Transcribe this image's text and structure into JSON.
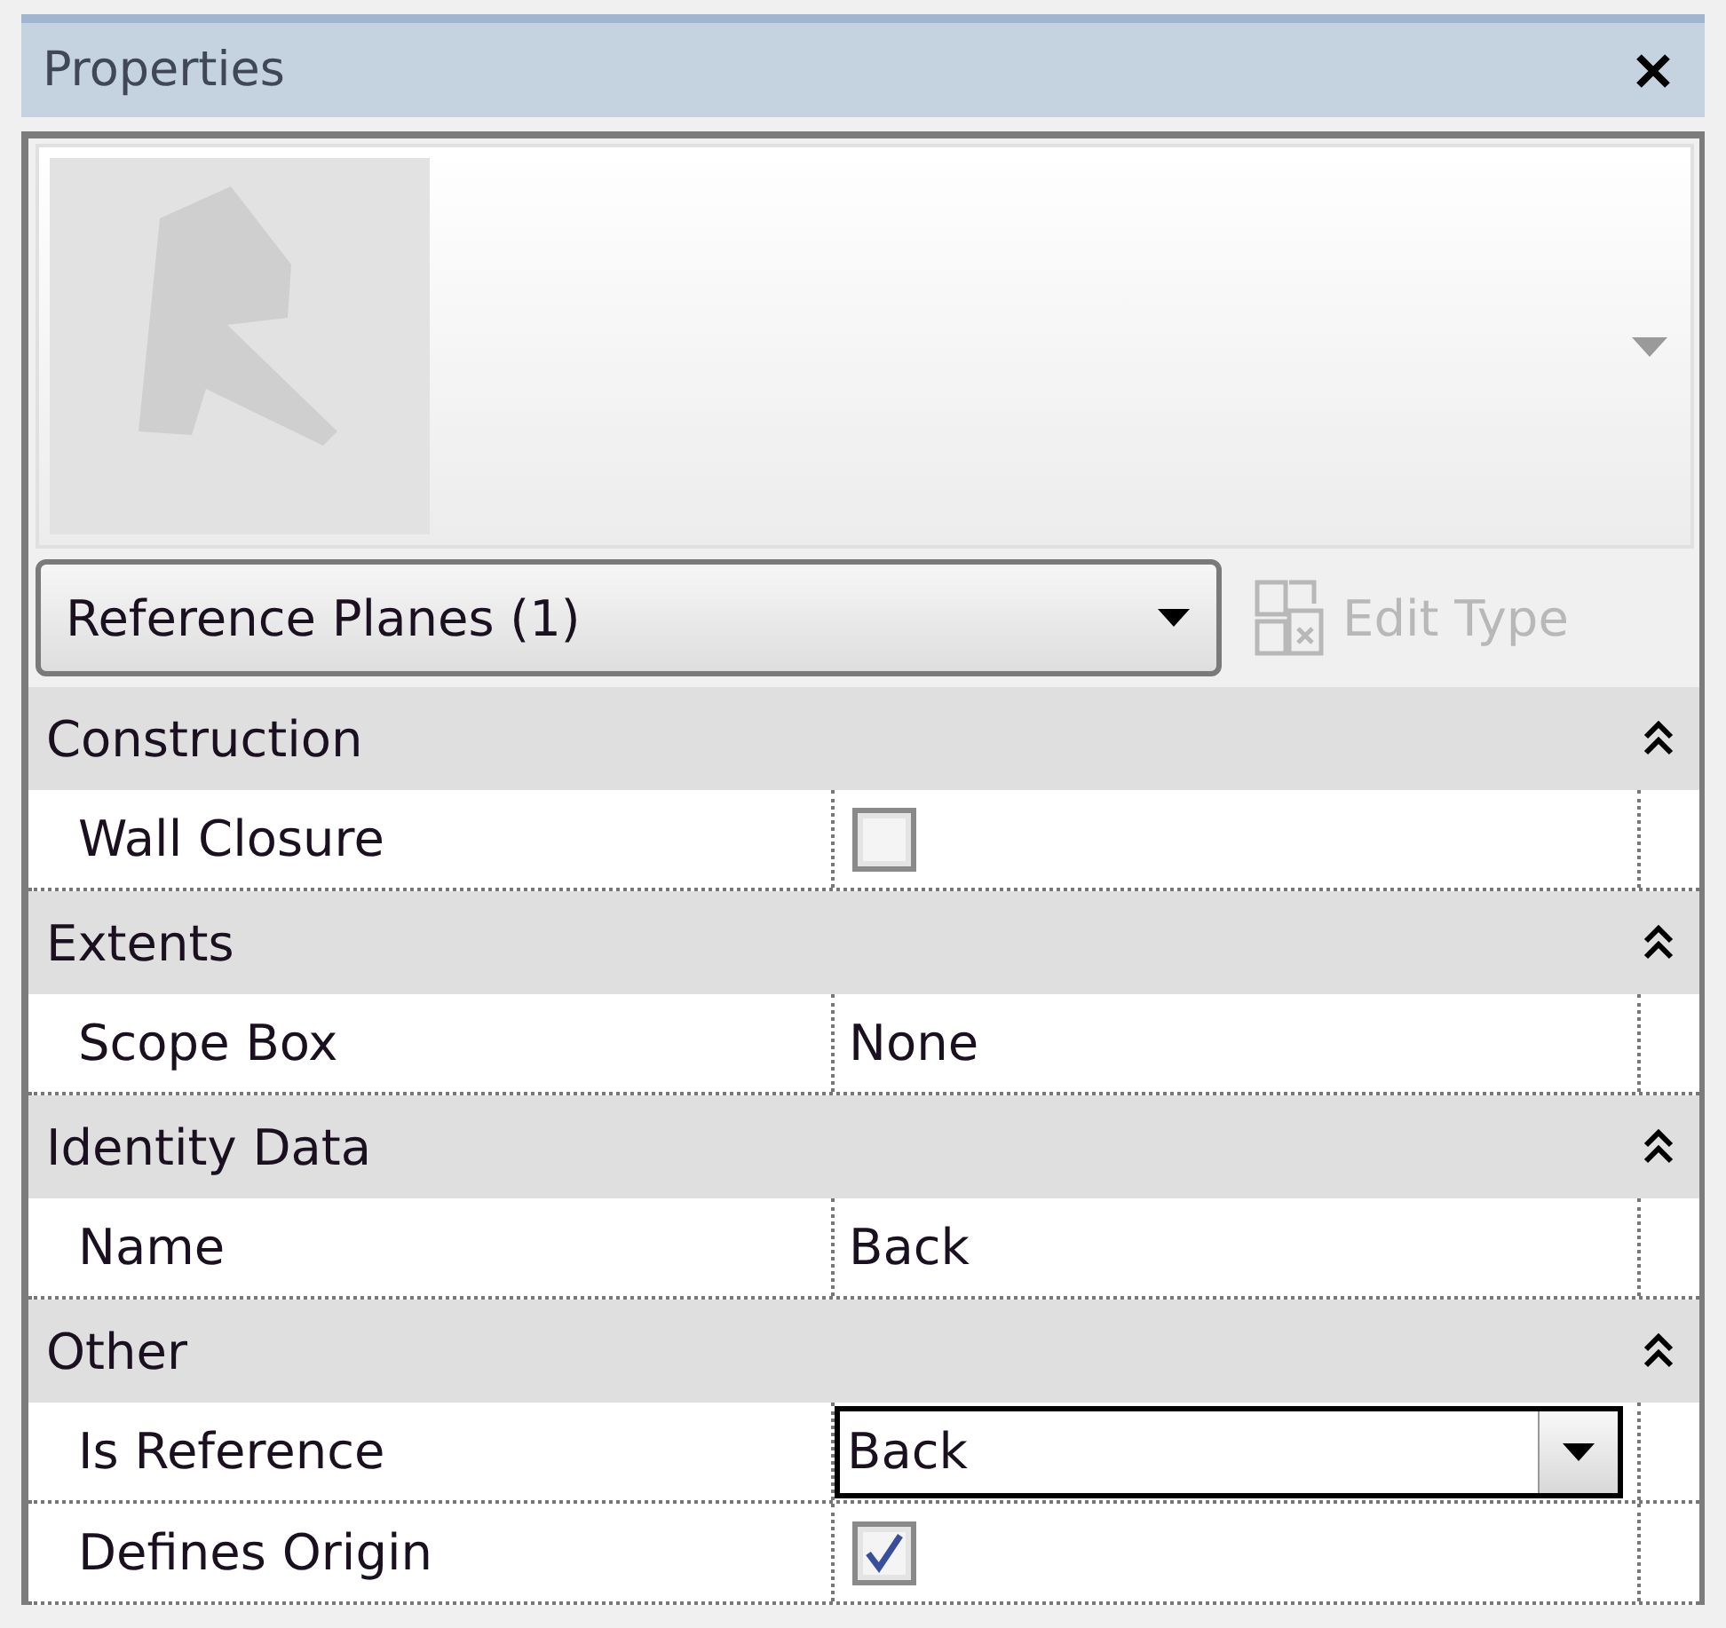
{
  "panel": {
    "title": "Properties"
  },
  "type_selector": {
    "value": "Reference Planes (1)"
  },
  "edit_type": {
    "label": "Edit Type",
    "disabled": true
  },
  "groups": [
    {
      "name": "Construction",
      "expanded": true,
      "rows": [
        {
          "label": "Wall Closure",
          "kind": "checkbox",
          "checked": false
        }
      ]
    },
    {
      "name": "Extents",
      "expanded": true,
      "rows": [
        {
          "label": "Scope Box",
          "kind": "text",
          "value": "None"
        }
      ]
    },
    {
      "name": "Identity Data",
      "expanded": true,
      "rows": [
        {
          "label": "Name",
          "kind": "text",
          "value": "Back"
        }
      ]
    },
    {
      "name": "Other",
      "expanded": true,
      "rows": [
        {
          "label": "Is Reference",
          "kind": "dropdown",
          "value": "Back"
        },
        {
          "label": "Defines Origin",
          "kind": "checkbox",
          "checked": true
        }
      ]
    }
  ]
}
